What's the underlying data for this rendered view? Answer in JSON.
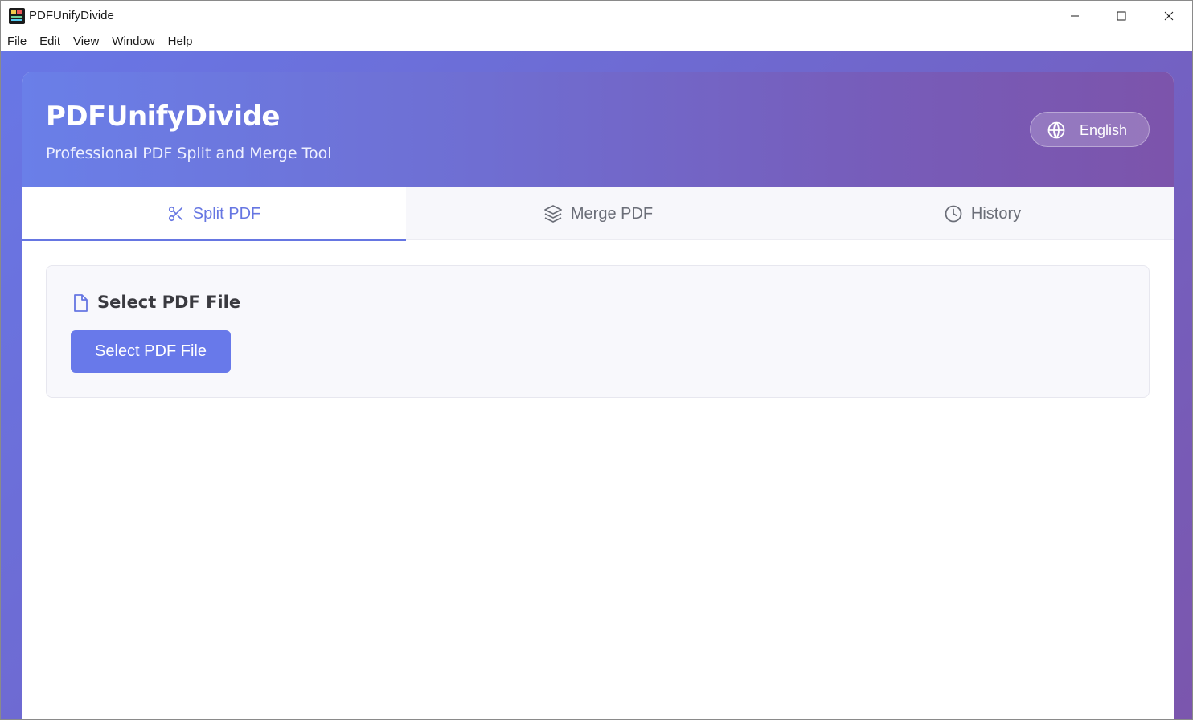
{
  "window": {
    "title": "PDFUnifyDivide"
  },
  "menu": [
    "File",
    "Edit",
    "View",
    "Window",
    "Help"
  ],
  "header": {
    "title": "PDFUnifyDivide",
    "subtitle": "Professional PDF Split and Merge Tool",
    "language_label": "English"
  },
  "tabs": [
    {
      "label": "Split PDF",
      "icon": "scissors-icon",
      "active": true
    },
    {
      "label": "Merge PDF",
      "icon": "layers-icon",
      "active": false
    },
    {
      "label": "History",
      "icon": "clock-icon",
      "active": false
    }
  ],
  "panel": {
    "title": "Select PDF File",
    "icon": "file-icon",
    "button_label": "Select PDF File"
  },
  "colors": {
    "accent": "#6676e2",
    "button": "#6879ea",
    "header_start": "#6a7fe8",
    "header_end": "#7c54ab"
  }
}
